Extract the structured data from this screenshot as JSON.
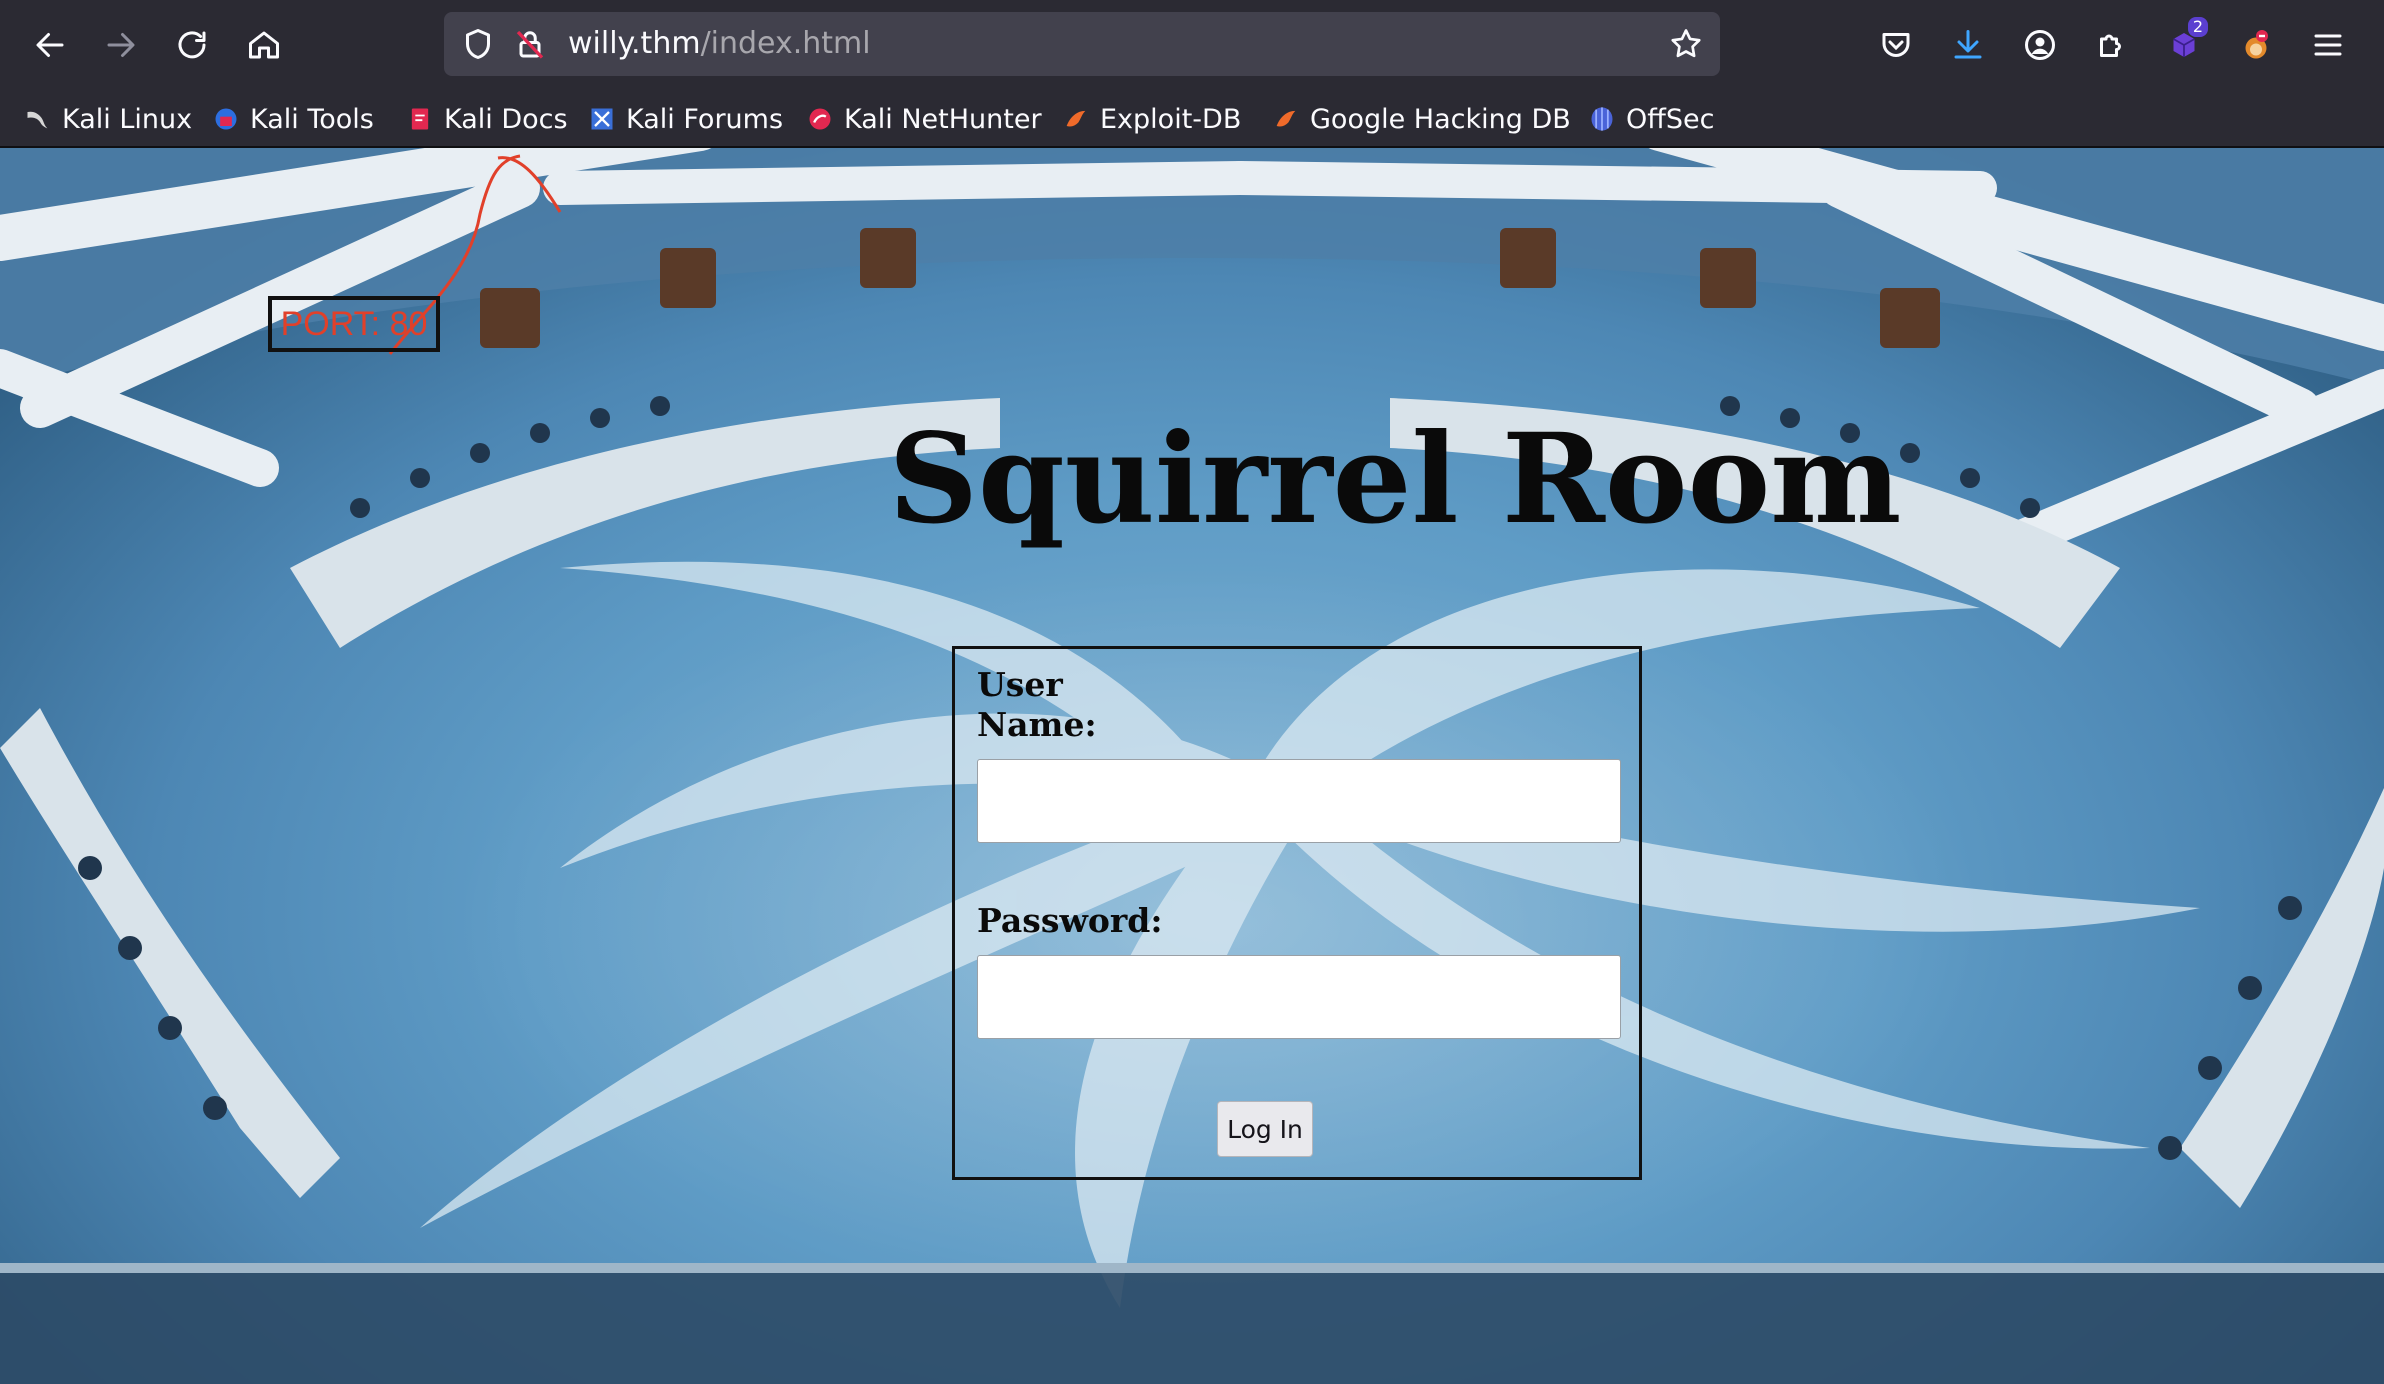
{
  "browser": {
    "url_host": "willy.thm",
    "url_path": "/index.html",
    "extensions_badge": "2",
    "bookmarks": [
      {
        "label": "Kali Linux",
        "icon": "kali-dragon-icon"
      },
      {
        "label": "Kali Tools",
        "icon": "kali-tools-icon"
      },
      {
        "label": "Kali Docs",
        "icon": "kali-docs-icon"
      },
      {
        "label": "Kali Forums",
        "icon": "kali-forums-icon"
      },
      {
        "label": "Kali NetHunter",
        "icon": "nethunter-icon"
      },
      {
        "label": "Exploit-DB",
        "icon": "exploit-db-icon"
      },
      {
        "label": "Google Hacking DB",
        "icon": "ghdb-icon"
      },
      {
        "label": "OffSec",
        "icon": "offsec-icon"
      }
    ]
  },
  "annotation": {
    "label": "PORT: 80",
    "color": "#e1402a"
  },
  "page": {
    "title": "Squirrel Room",
    "form": {
      "username_label_line1": "User",
      "username_label_line2": "Name:",
      "username_value": "",
      "password_label": "Password:",
      "password_value": "",
      "submit_label": "Log In"
    }
  }
}
